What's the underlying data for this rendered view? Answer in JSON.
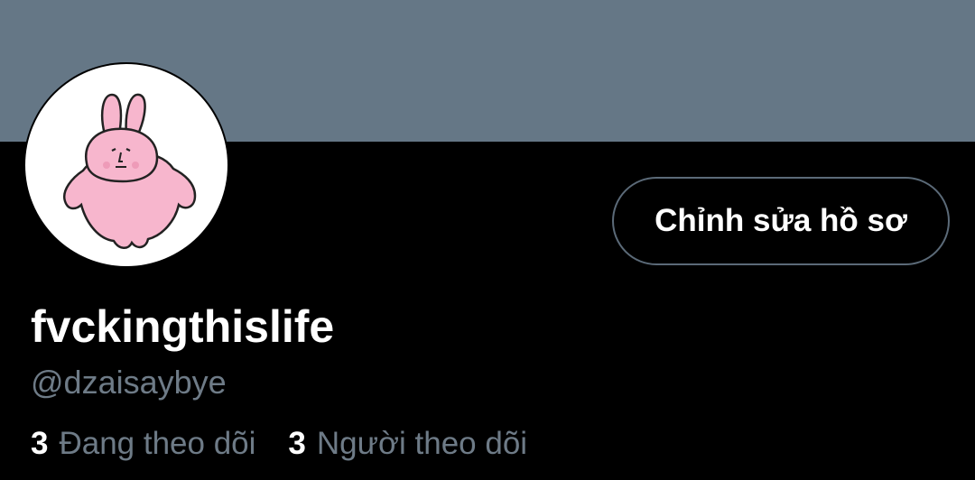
{
  "profile": {
    "display_name": "fvckingthislife",
    "handle": "@dzaisaybye",
    "edit_button_label": "Chỉnh sửa hồ sơ",
    "avatar_icon": "pink-bunny-avatar"
  },
  "stats": {
    "following_count": "3",
    "following_label": "Đang theo dõi",
    "followers_count": "3",
    "followers_label": "Người theo dõi"
  },
  "colors": {
    "banner": "#657786",
    "background": "#000000",
    "muted_text": "#6e7b87",
    "avatar_pink": "#f7b6cd"
  }
}
